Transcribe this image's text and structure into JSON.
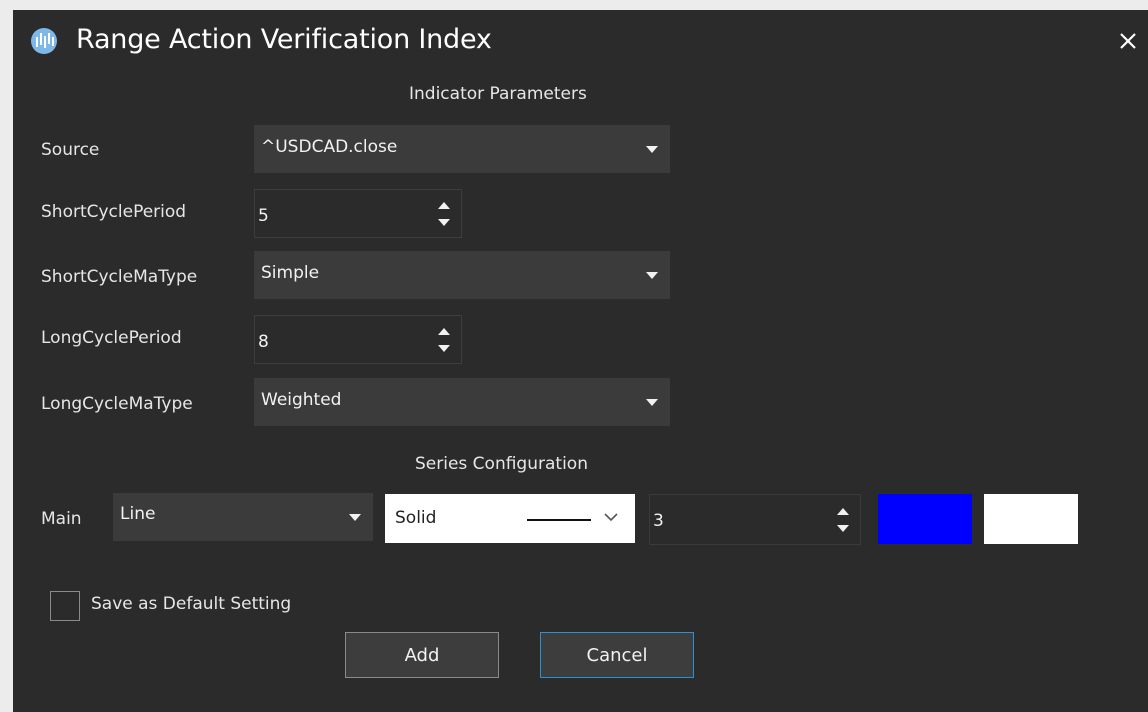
{
  "window": {
    "title": "Range Action Verification Index"
  },
  "sections": {
    "indicator_parameters": "Indicator Parameters",
    "series_configuration": "Series Configuration"
  },
  "params": {
    "source": {
      "label": "Source",
      "value": "^USDCAD.close"
    },
    "short_cycle_period": {
      "label": "ShortCyclePeriod",
      "value": "5"
    },
    "short_cycle_ma_type": {
      "label": "ShortCycleMaType",
      "value": "Simple"
    },
    "long_cycle_period": {
      "label": "LongCyclePeriod",
      "value": "8"
    },
    "long_cycle_ma_type": {
      "label": "LongCycleMaType",
      "value": "Weighted"
    }
  },
  "series": {
    "main": {
      "label": "Main",
      "type": "Line",
      "line_style": "Solid",
      "width": "3",
      "color": "#0000ff",
      "secondary_color": "#ffffff"
    }
  },
  "save_default": {
    "label": "Save as Default Setting",
    "checked": false
  },
  "buttons": {
    "add": "Add",
    "cancel": "Cancel"
  },
  "icons": {
    "app": "app-logo-icon",
    "close": "close-icon",
    "dropdown": "caret-down-icon",
    "spinner": "spinner-arrows-icon",
    "chevron": "chevron-down-icon"
  },
  "colors": {
    "background": "#2b2b2b",
    "input": "#3b3b3b",
    "accent_border": "#2f8fd6"
  }
}
